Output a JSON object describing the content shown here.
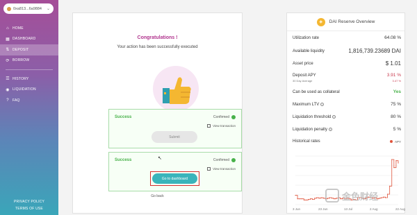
{
  "wallet": {
    "address": "0xa813...6a9884"
  },
  "nav": {
    "home": "HOME",
    "dashboard": "DASHBOARD",
    "deposit": "DEPOSIT",
    "borrow": "BORROW",
    "history": "HISTORY",
    "liquidation": "LIQUIDATION",
    "faq": "FAQ"
  },
  "legal": {
    "privacy": "PRIVACY POLICY",
    "terms": "TERMS OF USE"
  },
  "main": {
    "title": "Congratulations !",
    "subtitle": "Your action has been successfully executed",
    "box1": {
      "status": "Success",
      "confirmed": "Confirmed",
      "view_tx": "View transaction",
      "button": "Submit"
    },
    "box2": {
      "status": "Success",
      "confirmed": "Confirmed",
      "view_tx": "View transaction",
      "button": "Go to dashboard"
    },
    "go_back": "Go back"
  },
  "panel": {
    "title": "DAI Reserve Overview",
    "utilization_label": "Utilization rate",
    "utilization_value": "64.08 %",
    "liquidity_label": "Available liquidity",
    "liquidity_value": "1,816,739.23689 DAI",
    "price_label": "Asset price",
    "price_value": "$ 1.01",
    "apy_label": "Deposit APY",
    "apy_value": "3.91 %",
    "avg_label": "30 Day Average",
    "avg_value": "3.47 %",
    "collateral_label": "Can be used as collateral",
    "collateral_value": "Yes",
    "ltv_label": "Maximum LTV",
    "ltv_value": "75 %",
    "threshold_label": "Liquidation threshold",
    "threshold_value": "80 %",
    "penalty_label": "Liquidation penalty",
    "penalty_value": "5 %",
    "history_label": "Historical rates",
    "legend_label": "APY"
  },
  "chart_data": {
    "type": "line",
    "x_ticks": [
      "3 Jun",
      "23 Jun",
      "13 Jul",
      "2 Aug",
      "22 Aug"
    ],
    "series": [
      {
        "name": "APY",
        "color": "#e0533b",
        "values": [
          0.8,
          0.5,
          0.5,
          0.5,
          0.4,
          0.4,
          0.45,
          0.5,
          0.45,
          0.55,
          0.6,
          0.55,
          0.6,
          0.55,
          0.5,
          0.55,
          0.6,
          0.55,
          0.5,
          0.55,
          0.6,
          0.5,
          0.55,
          0.5,
          0.55,
          0.5,
          0.4,
          0.45,
          0.4,
          0.6,
          0.6,
          0.55,
          0.5,
          0.6,
          0.65,
          0.6,
          0.55,
          0.6,
          0.5,
          0.55,
          0.6,
          0.65,
          0.6,
          0.9,
          1.6,
          3.9,
          3.2,
          3.8,
          3.6
        ]
      }
    ],
    "ylim": [
      0,
      4.2
    ],
    "grid": true,
    "legend": "top-right"
  },
  "watermark": {
    "text": "金色财经"
  }
}
